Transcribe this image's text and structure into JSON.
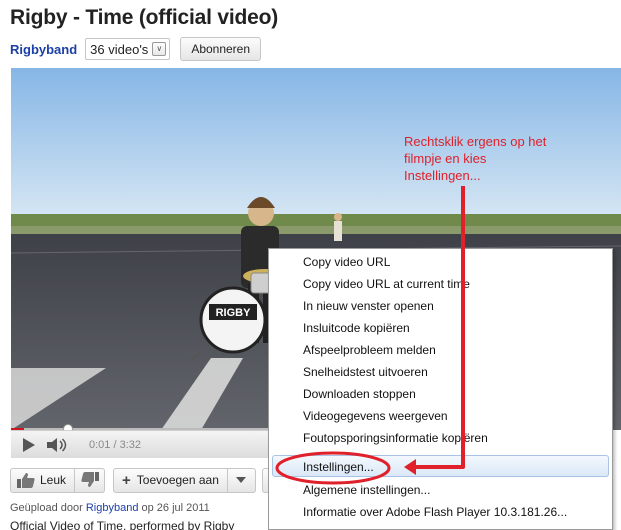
{
  "video": {
    "title": "Rigby - Time (official video)"
  },
  "channel": {
    "name": "Rigbyband",
    "video_count": "36 video's",
    "subscribe_label": "Abonneren"
  },
  "player": {
    "time_display": "0:01 / 3:32",
    "progress_fraction": 0.05,
    "drum_text": "RIGBY"
  },
  "annotation": {
    "text": "Rechtsklik ergens op het filmpje en kies Instellingen..."
  },
  "context_menu": {
    "items": [
      "Copy video URL",
      "Copy video URL at current time",
      "In nieuw venster openen",
      "Insluitcode kopiëren",
      "Afspeelprobleem melden",
      "Snelheidstest uitvoeren",
      "Downloaden stoppen",
      "Videogegevens weergeven",
      "Foutopsporingsinformatie kopiëren",
      "Instellingen...",
      "Algemene instellingen...",
      "Informatie over Adobe Flash Player 10.3.181.26..."
    ],
    "highlighted_index": 9
  },
  "actions": {
    "like_label": "Leuk",
    "add_label": "Toevoegen aan"
  },
  "upload_info": {
    "prefix": "Geüpload door",
    "uploader": "Rigbyband",
    "date": "op 26 jul 2011"
  },
  "description": {
    "text": "Official Video of Time, performed by Rigby"
  },
  "colors": {
    "annotation_red": "#e0202a",
    "channel_link": "#1c3fa8",
    "progress_red": "#cc181e",
    "menu_highlight": "#dbe8f7"
  },
  "icons": {
    "play": "play-icon",
    "volume": "volume-icon",
    "like": "thumbs-up-icon",
    "dislike": "thumbs-down-icon",
    "toggle": "double-chevron-down-icon",
    "dropdown": "caret-down-icon"
  }
}
